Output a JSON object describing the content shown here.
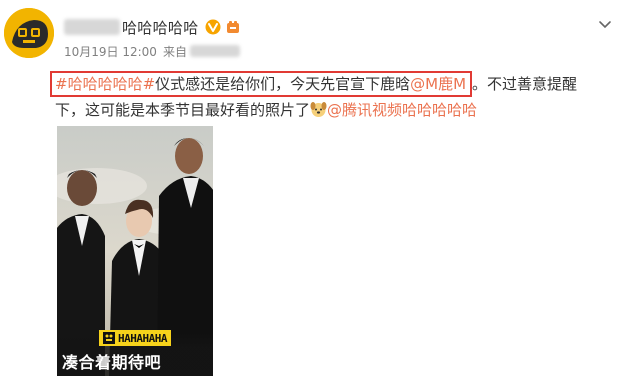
{
  "post_header": {
    "username": "哈哈哈哈哈",
    "timestamp": "10月19日 12:00",
    "source_prefix": "来自"
  },
  "post_body": {
    "line1": {
      "topic": "#哈哈哈哈哈#",
      "text1": "仪式感还是给你们，今天先官宣下鹿晗",
      "mention": "@M鹿M",
      "text2": "。不过善意提醒"
    },
    "line2": {
      "text": "下，这可能是本季节目最好看的照片了",
      "mention": "@腾讯视频哈哈哈哈哈"
    }
  },
  "photo": {
    "show_logo": "HAHAHAHA",
    "caption": "凑合着期待吧"
  },
  "icons": {
    "avatar": "cartoon-face-icon",
    "verified": "verified-v-icon",
    "level": "level-badge-icon",
    "menu": "chevron-down-icon",
    "emoji": "dog-face-emoji-icon"
  },
  "colors": {
    "link": "#eb7350",
    "highlight_box": "#e13a34",
    "verified": "#f7a400",
    "meta_text": "#808080"
  }
}
